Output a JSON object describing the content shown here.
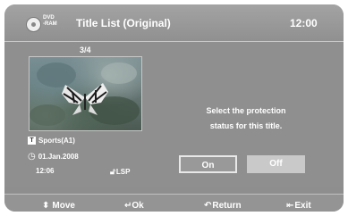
{
  "header": {
    "disc_top": "DVD",
    "disc_bottom": "-RAM",
    "title": "Title List (Original)",
    "clock": "12:00"
  },
  "thumbnail": {
    "counter": "3/4"
  },
  "info": {
    "name": "Sports(A1)",
    "date": "01.Jan.2008",
    "time": "12:06",
    "mode": "LSP"
  },
  "dialog": {
    "message_line1": "Select the protection",
    "message_line2": "status for this title.",
    "on_label": "On",
    "off_label": "Off",
    "selected": "On"
  },
  "footer": {
    "move": "Move",
    "ok": "Ok",
    "return": "Return",
    "exit": "Exit"
  }
}
